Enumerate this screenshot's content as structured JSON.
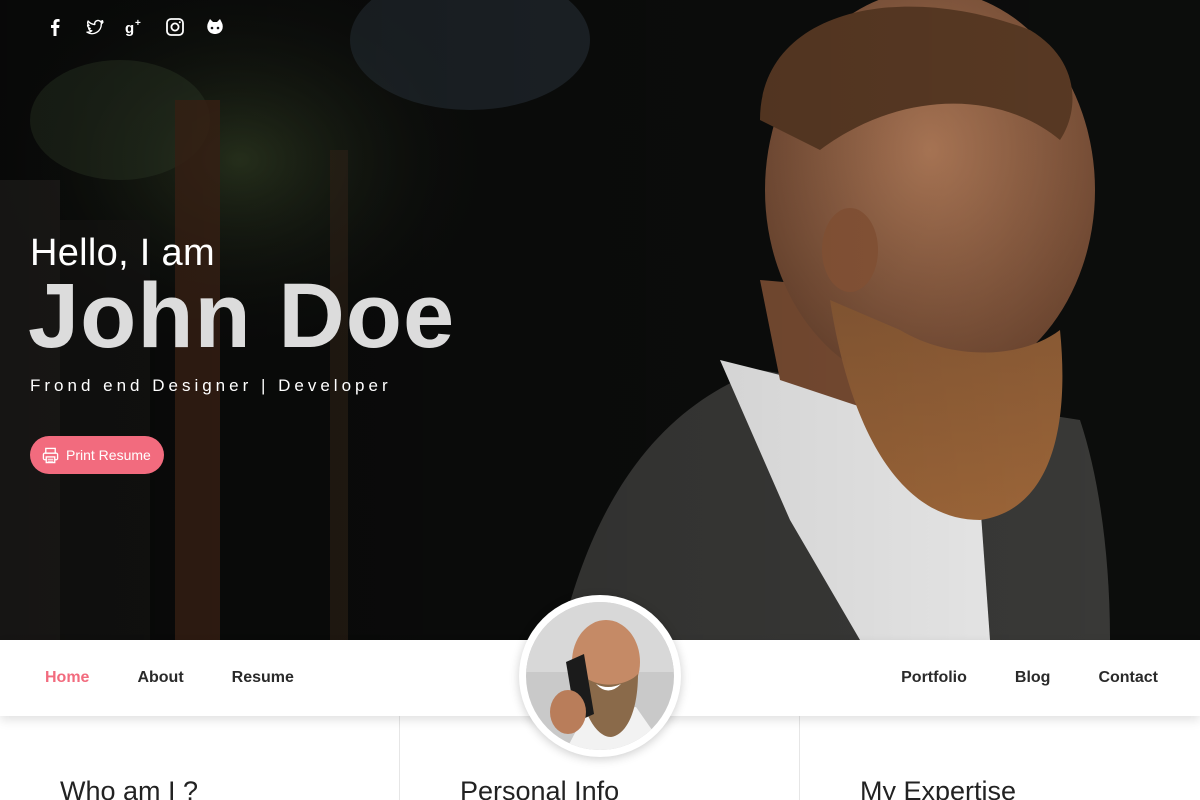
{
  "social": {
    "icons": [
      "facebook-icon",
      "twitter-icon",
      "google-plus-icon",
      "instagram-icon",
      "github-icon"
    ]
  },
  "hero": {
    "greeting": "Hello, I am",
    "name": "John Doe",
    "role": "Frond end Designer | Developer",
    "print_button": "Print Resume",
    "accent_color": "#f26b7e"
  },
  "nav": {
    "left": [
      "Home",
      "About",
      "Resume"
    ],
    "right": [
      "Portfolio",
      "Blog",
      "Contact"
    ],
    "active": "Home"
  },
  "sections": {
    "col1_title": "Who am I ?",
    "col2_title": "Personal Info",
    "col3_title": "My Expertise"
  }
}
